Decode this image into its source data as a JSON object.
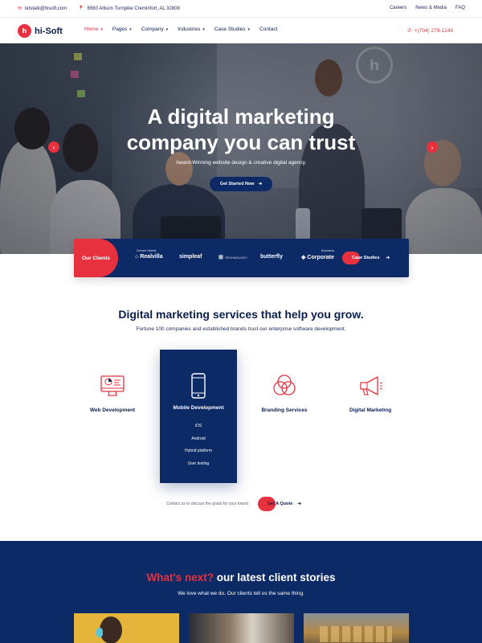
{
  "topbar": {
    "email": "letstalk@hisoft.com",
    "address": "6560 Allison Turnpike Creminfort, AL 32808",
    "links": [
      "Careers",
      "News & Media",
      "FAQ"
    ]
  },
  "nav": {
    "logo_mark": "h",
    "logo_text": "hi-Soft",
    "items": [
      "Home",
      "Pages",
      "Company",
      "Industries",
      "Case Studies",
      "Contact"
    ],
    "phone": "+(704) 279-1249"
  },
  "hero": {
    "title_line1": "A digital marketing",
    "title_line2": "company you can trust",
    "subtitle": "Award-Winning website design & creative digital agency.",
    "cta": "Get Started Now"
  },
  "clients": {
    "label": "Our Clients",
    "logos": [
      "Realvilla",
      "simpleaf",
      "TECHNOLOGY",
      "butterfly",
      "Corporate"
    ],
    "logo_small": [
      "Dream Hotels",
      "",
      "",
      "",
      "Business"
    ],
    "case_studies": "Case Studies"
  },
  "services": {
    "title": "Digital marketing services that help you grow.",
    "subtitle": "Fortune 100 companies and established brands trust our enterprise software development.",
    "items": [
      "Web Development",
      "Mobile Development",
      "Branding Services",
      "Digital Marketing"
    ],
    "mobile_list": [
      "iOS",
      "Android",
      "Hybrid platform",
      "User testing"
    ],
    "contact_text": "Contact us to discuss the goals for your brand",
    "quote_button": "Get A Quote"
  },
  "stories": {
    "title_highlight": "What's next?",
    "title_rest": " our latest client stories",
    "subtitle": "We love what we do. Our clients tell us the same thing."
  },
  "colors": {
    "brand_red": "#e8313f",
    "navy": "#0b2a66",
    "text_dark": "#0b1f4d"
  },
  "icons": [
    "mail-icon",
    "location-pin-icon",
    "phone-icon",
    "monitor-chart-icon",
    "smartphone-icon",
    "venn-circles-icon",
    "megaphone-icon",
    "arrow-right-icon",
    "chevron-left-icon",
    "chevron-right-icon"
  ]
}
